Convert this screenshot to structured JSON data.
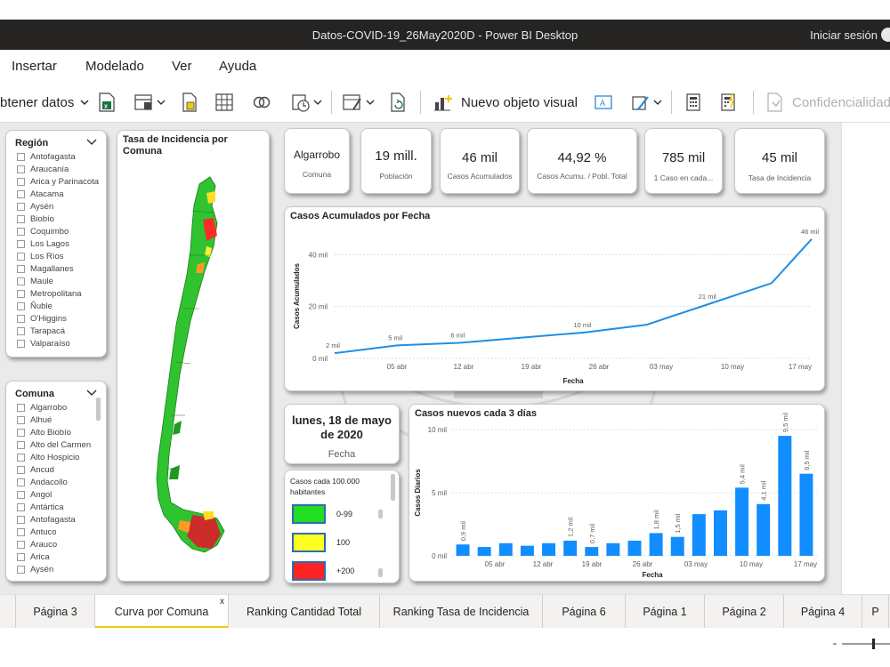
{
  "window": {
    "title": "Datos-COVID-19_26May2020D - Power BI Desktop",
    "signin": "Iniciar sesión"
  },
  "menu": [
    "Insertar",
    "Modelado",
    "Ver",
    "Ayuda"
  ],
  "ribbon": {
    "get_data": "btener datos",
    "new_visual": "Nuevo objeto visual",
    "confidential": "Confidencialidad"
  },
  "region_slicer": {
    "title": "Región",
    "items": [
      "Antofagasta",
      "Araucanía",
      "Arica y Parinacota",
      "Atacama",
      "Aysén",
      "Biobío",
      "Coquimbo",
      "Los Lagos",
      "Los Ríos",
      "Magallanes",
      "Maule",
      "Metropolitana",
      "Ñuble",
      "O'Higgins",
      "Tarapacá",
      "Valparaíso"
    ]
  },
  "comuna_slicer": {
    "title": "Comuna",
    "items": [
      "Algarrobo",
      "Alhué",
      "Alto Biobío",
      "Alto del Carmen",
      "Alto Hospicio",
      "Ancud",
      "Andacollo",
      "Angol",
      "Antártica",
      "Antofagasta",
      "Antuco",
      "Arauco",
      "Arica",
      "Aysén"
    ]
  },
  "map": {
    "title": "Tasa de Incidencia por Comuna"
  },
  "kpis": [
    {
      "value": "Algarrobo",
      "label": "Comuna"
    },
    {
      "value": "19 mill.",
      "label": "Población"
    },
    {
      "value": "46 mil",
      "label": "Casos Acumulados"
    },
    {
      "value": "44,92 %",
      "label": "Casos Acumu. / Pobl. Total"
    },
    {
      "value": "785 mil",
      "label": "1 Caso en cada..."
    },
    {
      "value": "45 mil",
      "label": "Tasa de Incidencia"
    }
  ],
  "date_card": {
    "value": "lunes, 18 de mayo de 2020",
    "label": "Fecha"
  },
  "legend": {
    "title": "Casos cada 100.000 habitantes",
    "items": [
      {
        "label": "0-99",
        "color": "#22dd22"
      },
      {
        "label": "100",
        "color": "#ffff22"
      },
      {
        "label": "+200",
        "color": "#ff2222"
      }
    ]
  },
  "chart_data": [
    {
      "type": "line",
      "title": "Casos Acumulados por Fecha",
      "xlabel": "Fecha",
      "ylabel": "Casos Acumulados",
      "x_ticks": [
        "05 abr",
        "12 abr",
        "19 abr",
        "26 abr",
        "03 may",
        "10 may",
        "17 may"
      ],
      "y_ticks": [
        "0 mil",
        "20 mil",
        "40 mil"
      ],
      "ylim": [
        0,
        48
      ],
      "x": [
        0,
        7,
        14,
        21,
        28,
        35,
        42,
        49,
        53.5
      ],
      "values": [
        2,
        5,
        6,
        8,
        10,
        13,
        21,
        29,
        46
      ],
      "data_labels": [
        "2 mil",
        "5 mil",
        "6 mil",
        "",
        "10 mil",
        "",
        "21 mil",
        "",
        "46 mil"
      ],
      "color": "#1f8fe5",
      "grid": true
    },
    {
      "type": "bar",
      "title": "Casos nuevos cada 3 días",
      "xlabel": "Fecha",
      "ylabel": "Casos Diarios",
      "x_ticks": [
        "05 abr",
        "12 abr",
        "19 abr",
        "26 abr",
        "03 may",
        "10 may",
        "17 may"
      ],
      "y_ticks": [
        "0 mil",
        "5 mil",
        "10 mil"
      ],
      "ylim": [
        0,
        10
      ],
      "values": [
        0.9,
        0.7,
        1.0,
        0.8,
        1.0,
        1.2,
        0.7,
        1.0,
        1.2,
        1.8,
        1.5,
        3.3,
        3.6,
        5.4,
        4.1,
        9.5,
        6.5
      ],
      "data_labels": [
        "0,9 mil",
        "",
        "",
        "",
        "",
        "1,2 mil",
        "0,7 mil",
        "",
        "",
        "1,8 mil",
        "1,5 mil",
        "",
        "",
        "5,4 mil",
        "4,1 mil",
        "9,5 mil",
        "6,5 mil"
      ],
      "color": "#118dff",
      "grid": true
    }
  ],
  "tabs": [
    {
      "label": "Página 3",
      "active": false
    },
    {
      "label": "Curva por Comuna",
      "active": true
    },
    {
      "label": "Ranking Cantidad Total",
      "active": false
    },
    {
      "label": "Ranking Tasa de Incidencia",
      "active": false
    },
    {
      "label": "Página 6",
      "active": false
    },
    {
      "label": "Página 1",
      "active": false
    },
    {
      "label": "Página 2",
      "active": false
    },
    {
      "label": "Página 4",
      "active": false
    },
    {
      "label": "P",
      "active": false
    }
  ],
  "tab_close": "x"
}
